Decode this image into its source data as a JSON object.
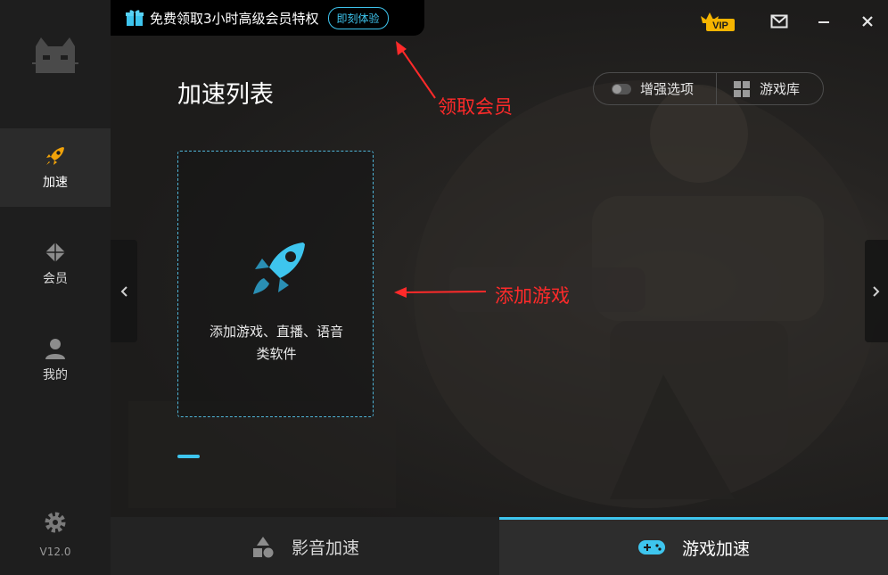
{
  "promo": {
    "text": "免费领取3小时高级会员特权",
    "button": "即刻体验"
  },
  "window_controls": {
    "vip_label": "VIP",
    "icons": [
      "mail-icon",
      "minimize-icon",
      "close-icon"
    ]
  },
  "sidebar": {
    "items": [
      {
        "label": "加速",
        "icon": "rocket-icon",
        "active": true
      },
      {
        "label": "会员",
        "icon": "diamond-icon",
        "active": false
      },
      {
        "label": "我的",
        "icon": "user-icon",
        "active": false
      }
    ],
    "settings_icon": "gear-icon",
    "version": "V12.0"
  },
  "main": {
    "title": "加速列表",
    "enhance_label": "增强选项",
    "library_label": "游戏库",
    "add_card_line1": "添加游戏、直播、语音",
    "add_card_line2": "类软件"
  },
  "annotations": {
    "member": "领取会员",
    "add_game": "添加游戏"
  },
  "tabs": [
    {
      "label": "影音加速",
      "icon": "shapes-icon",
      "active": false
    },
    {
      "label": "游戏加速",
      "icon": "gamepad-icon",
      "active": true
    }
  ],
  "colors": {
    "accent": "#3ec5ee",
    "vip_gold": "#f5b400",
    "annotation_red": "#ff2a2a",
    "rocket_orange": "#f0a20a"
  }
}
